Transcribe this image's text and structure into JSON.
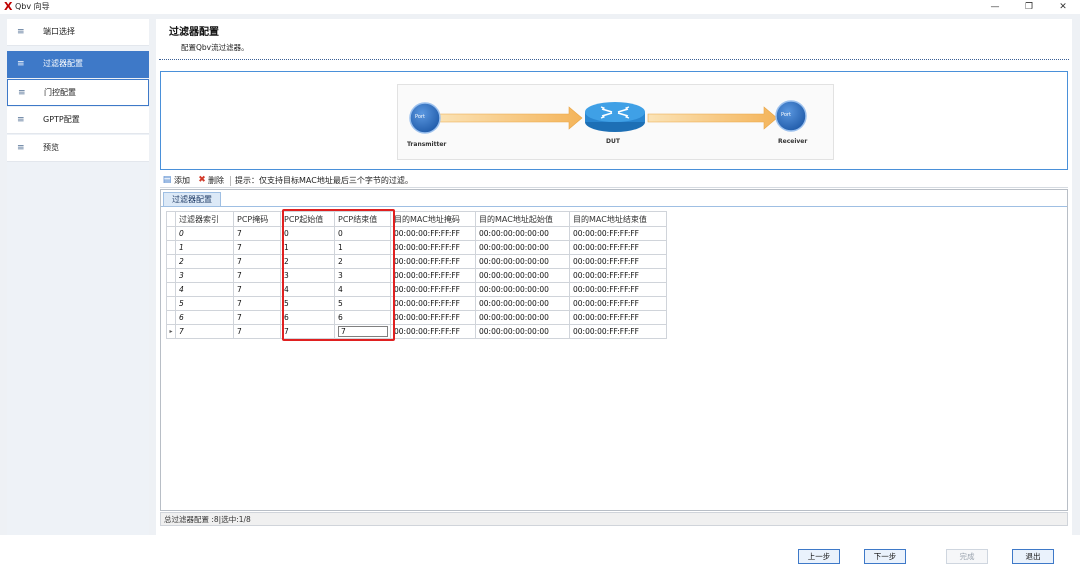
{
  "window": {
    "logo": "X",
    "title": "Qbv 向导",
    "minimize_glyph": "—",
    "restore_glyph": "❐",
    "close_glyph": "✕"
  },
  "sidebar": {
    "items": [
      {
        "label": "端口选择",
        "icon": "list-icon",
        "glyph": "≡",
        "state": "normal"
      },
      {
        "label": "过滤器配置",
        "icon": "list-icon",
        "glyph": "≡",
        "state": "active"
      },
      {
        "label": "门控配置",
        "icon": "list-icon",
        "glyph": "≡",
        "state": "hover"
      },
      {
        "label": "GPTP配置",
        "icon": "list-icon",
        "glyph": "≡",
        "state": "normal"
      },
      {
        "label": "预览",
        "icon": "list-icon",
        "glyph": "≡",
        "state": "normal"
      }
    ]
  },
  "header": {
    "title": "过滤器配置",
    "subtitle": "配置Qbv流过滤器。"
  },
  "diagram": {
    "left_port": "Port",
    "left_label": "Transmitter",
    "center_label": "DUT",
    "right_port": "Port",
    "right_label": "Receiver"
  },
  "toolbar": {
    "add_label": "添加",
    "delete_label": "删除",
    "hint": "提示：仅支持目标MAC地址最后三个字节的过滤。"
  },
  "grid": {
    "tab_label": "过滤器配置",
    "columns": [
      "过滤器索引",
      "PCP掩码",
      "PCP起始值",
      "PCP结束值",
      "目的MAC地址掩码",
      "目的MAC地址起始值",
      "目的MAC地址结束值"
    ],
    "rows": [
      [
        "0",
        "7",
        "0",
        "0",
        "00:00:00:FF:FF:FF",
        "00:00:00:00:00:00",
        "00:00:00:FF:FF:FF"
      ],
      [
        "1",
        "7",
        "1",
        "1",
        "00:00:00:FF:FF:FF",
        "00:00:00:00:00:00",
        "00:00:00:FF:FF:FF"
      ],
      [
        "2",
        "7",
        "2",
        "2",
        "00:00:00:FF:FF:FF",
        "00:00:00:00:00:00",
        "00:00:00:FF:FF:FF"
      ],
      [
        "3",
        "7",
        "3",
        "3",
        "00:00:00:FF:FF:FF",
        "00:00:00:00:00:00",
        "00:00:00:FF:FF:FF"
      ],
      [
        "4",
        "7",
        "4",
        "4",
        "00:00:00:FF:FF:FF",
        "00:00:00:00:00:00",
        "00:00:00:FF:FF:FF"
      ],
      [
        "5",
        "7",
        "5",
        "5",
        "00:00:00:FF:FF:FF",
        "00:00:00:00:00:00",
        "00:00:00:FF:FF:FF"
      ],
      [
        "6",
        "7",
        "6",
        "6",
        "00:00:00:FF:FF:FF",
        "00:00:00:00:00:00",
        "00:00:00:FF:FF:FF"
      ],
      [
        "7",
        "7",
        "7",
        "7",
        "00:00:00:FF:FF:FF",
        "00:00:00:00:00:00",
        "00:00:00:FF:FF:FF"
      ]
    ],
    "current_row_marker": "▸",
    "status": "总过滤器配置 :8|选中:1/8"
  },
  "footer": {
    "prev_label": "上一步",
    "next_label": "下一步",
    "finish_label": "完成",
    "exit_label": "退出"
  },
  "colors": {
    "accent": "#3e79c8",
    "highlight_box": "#e02020",
    "port_circle": "#2f6fbf",
    "arrow": "#f7c67a"
  }
}
